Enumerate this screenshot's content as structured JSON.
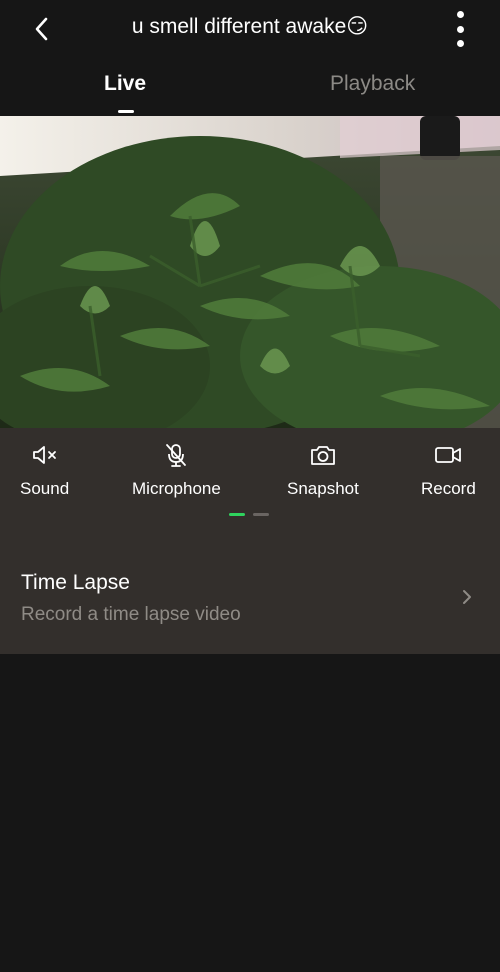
{
  "header": {
    "title": "u smell different awake😏"
  },
  "tabs": [
    {
      "label": "Live",
      "active": true
    },
    {
      "label": "Playback",
      "active": false
    }
  ],
  "controls": [
    {
      "label": "Sound",
      "icon": "speaker-muted-icon"
    },
    {
      "label": "Microphone",
      "icon": "microphone-off-icon"
    },
    {
      "label": "Snapshot",
      "icon": "camera-icon"
    },
    {
      "label": "Record",
      "icon": "video-camera-icon"
    }
  ],
  "pager": {
    "pages": 2,
    "current": 1
  },
  "time_lapse": {
    "title": "Time Lapse",
    "subtitle": "Record a time lapse video"
  },
  "colors": {
    "background": "#161616",
    "panel": "#332f2c",
    "accent_green": "#2fd35e",
    "inactive_text": "#8c8a86"
  }
}
